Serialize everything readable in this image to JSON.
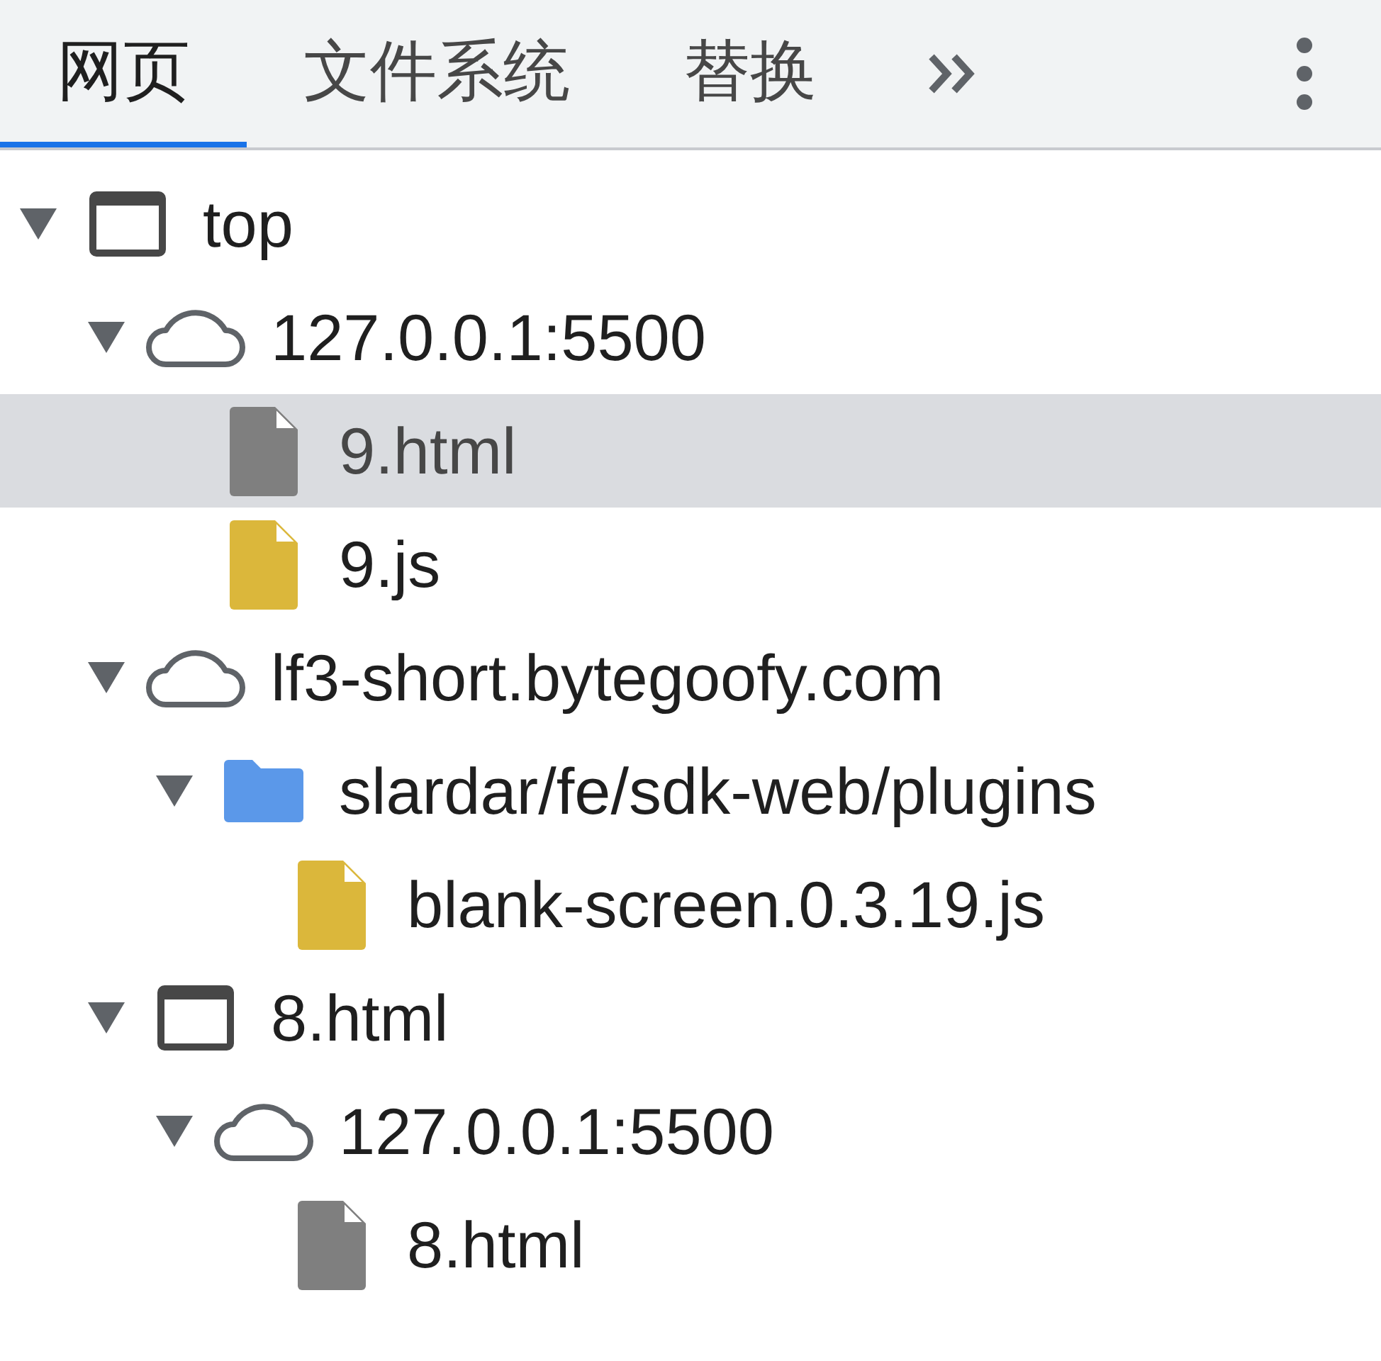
{
  "tabs": [
    {
      "label": "网页",
      "selected": true
    },
    {
      "label": "文件系统",
      "selected": false
    },
    {
      "label": "替换",
      "selected": false
    }
  ],
  "tree": [
    {
      "kind": "frame",
      "label": "top",
      "expanded": true,
      "selected": false,
      "children": [
        {
          "kind": "origin",
          "label": "127.0.0.1:5500",
          "expanded": true,
          "selected": false,
          "children": [
            {
              "kind": "document",
              "label": "9.html",
              "selected": true
            },
            {
              "kind": "script",
              "label": "9.js",
              "selected": false
            }
          ]
        },
        {
          "kind": "origin",
          "label": "lf3-short.bytegoofy.com",
          "expanded": true,
          "selected": false,
          "children": [
            {
              "kind": "folder",
              "label": "slardar/fe/sdk-web/plugins",
              "expanded": true,
              "selected": false,
              "children": [
                {
                  "kind": "script",
                  "label": "blank-screen.0.3.19.js",
                  "selected": false
                }
              ]
            }
          ]
        },
        {
          "kind": "frame",
          "label": "8.html",
          "expanded": true,
          "selected": false,
          "children": [
            {
              "kind": "origin",
              "label": "127.0.0.1:5500",
              "expanded": true,
              "selected": false,
              "children": [
                {
                  "kind": "document",
                  "label": "8.html",
                  "selected": false
                }
              ]
            }
          ]
        }
      ]
    }
  ]
}
